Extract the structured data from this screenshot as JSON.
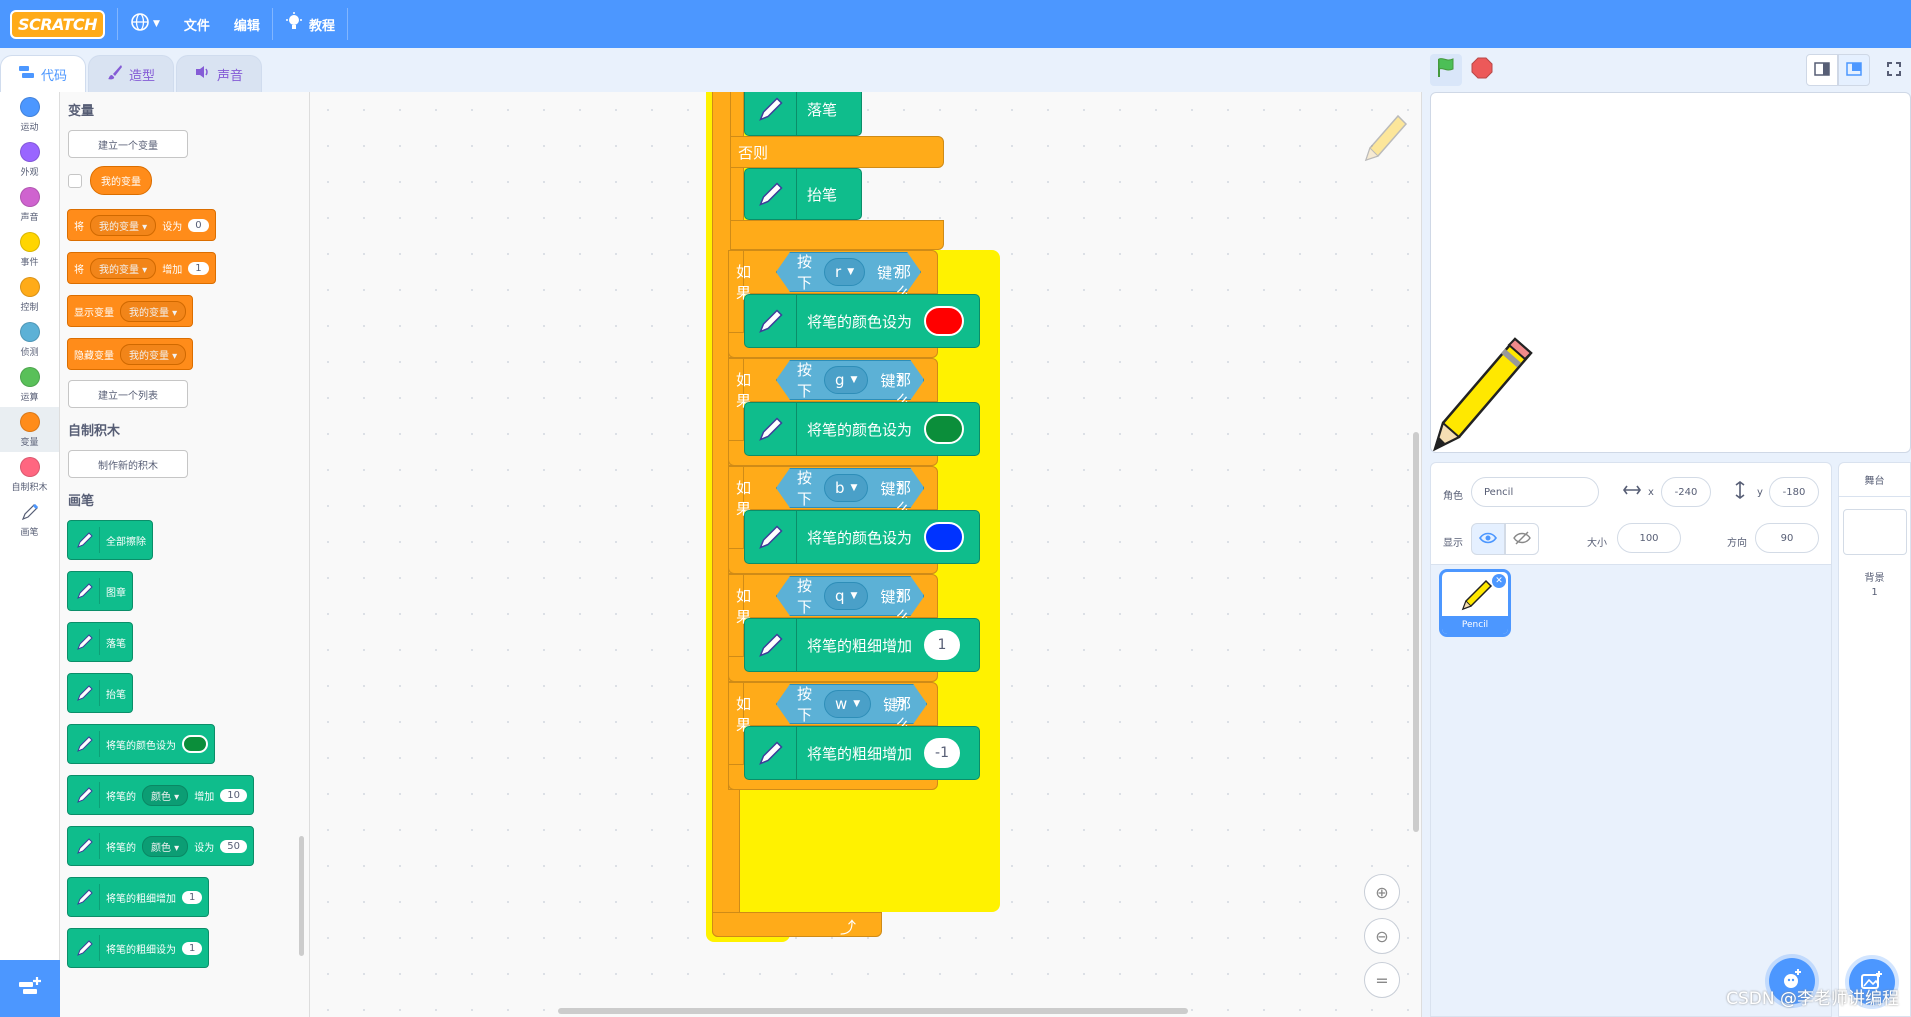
{
  "menu": {
    "logo": "SCRATCH",
    "file": "文件",
    "edit": "编辑",
    "tutorials": "教程"
  },
  "tabs": {
    "code": "代码",
    "costumes": "造型",
    "sounds": "声音"
  },
  "categories": [
    {
      "label": "运动",
      "color": "#4c97ff"
    },
    {
      "label": "外观",
      "color": "#9966ff"
    },
    {
      "label": "声音",
      "color": "#cf63cf"
    },
    {
      "label": "事件",
      "color": "#ffd500"
    },
    {
      "label": "控制",
      "color": "#ffab19"
    },
    {
      "label": "侦测",
      "color": "#5cb1d6"
    },
    {
      "label": "运算",
      "color": "#59c059"
    },
    {
      "label": "变量",
      "color": "#ff8c1a"
    },
    {
      "label": "自制积木",
      "color": "#ff6680"
    },
    {
      "label": "画笔",
      "color": "#0fbd8c"
    }
  ],
  "palette": {
    "variables_title": "变量",
    "make_variable": "建立一个变量",
    "my_variable": "我的变量",
    "set_prefix": "将",
    "set_mid": "设为",
    "set_value": "0",
    "change_prefix": "将",
    "change_mid": "增加",
    "change_value": "1",
    "show_var": "显示变量",
    "hide_var": "隐藏变量",
    "make_list": "建立一个列表",
    "myblocks_title": "自制积木",
    "make_block": "制作新的积木",
    "pen_title": "画笔",
    "erase_all": "全部擦除",
    "stamp": "图章",
    "pen_down": "落笔",
    "pen_up": "抬笔",
    "set_pen_color": "将笔的颜色设为",
    "pen_change_prefix": "将笔的",
    "color_param": "颜色",
    "change_word": "增加",
    "change_param_value": "10",
    "set_word": "设为",
    "set_param_value": "50",
    "change_size": "将笔的粗细增加",
    "change_size_value": "1",
    "set_size": "将笔的粗细设为",
    "set_size_value": "1"
  },
  "script": {
    "pen_down": "落笔",
    "else": "否则",
    "pen_up": "抬笔",
    "if": "如果",
    "then": "那么",
    "key_pressed_prefix": "按下",
    "key_pressed_suffix": "键?",
    "set_color": "将笔的颜色设为",
    "change_size": "将笔的粗细增加",
    "rows": [
      {
        "key": "r",
        "action": "color",
        "color": "#ff0000"
      },
      {
        "key": "g",
        "action": "color",
        "color": "#0b8e3a"
      },
      {
        "key": "b",
        "action": "color",
        "color": "#0033ff"
      },
      {
        "key": "q",
        "action": "size",
        "value": "1"
      },
      {
        "key": "w",
        "action": "size",
        "value": "-1"
      }
    ]
  },
  "sprite_info": {
    "sprite_label": "角色",
    "sprite_name": "Pencil",
    "x_label": "x",
    "x_value": "-240",
    "y_label": "y",
    "y_value": "-180",
    "show_label": "显示",
    "size_label": "大小",
    "size_value": "100",
    "direction_label": "方向",
    "direction_value": "90"
  },
  "sprites": [
    {
      "name": "Pencil"
    }
  ],
  "stage_panel": {
    "title": "舞台",
    "backdrops_label": "背景",
    "backdrops_count": "1"
  },
  "watermark": "CSDN @李老师讲编程"
}
